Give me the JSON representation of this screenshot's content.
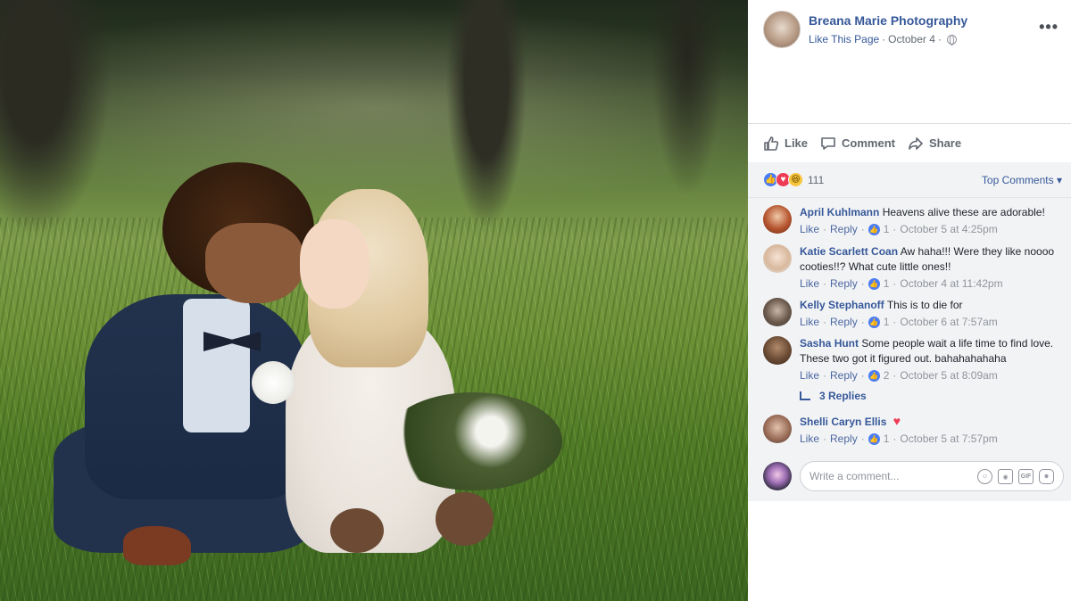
{
  "post": {
    "page_name": "Breana Marie Photography",
    "like_page": "Like This Page",
    "separator": "·",
    "date": "October 4",
    "more_label": "•••"
  },
  "actions": {
    "like": "Like",
    "comment": "Comment",
    "share": "Share"
  },
  "reactions": {
    "count": "111",
    "sort_label": "Top Comments",
    "sort_caret": "▾"
  },
  "comments": [
    {
      "author": "April Kuhlmann",
      "text": "Heavens alive these are adorable!",
      "like": "Like",
      "reply": "Reply",
      "likes": "1",
      "time": "October 5 at 4:25pm"
    },
    {
      "author": "Katie Scarlett Coan",
      "text": "Aw haha!!! Were they like noooo cooties!!? What cute little ones!!",
      "like": "Like",
      "reply": "Reply",
      "likes": "1",
      "time": "October 4 at 11:42pm"
    },
    {
      "author": "Kelly Stephanoff",
      "text": "This is to die for",
      "like": "Like",
      "reply": "Reply",
      "likes": "1",
      "time": "October 6 at 7:57am"
    },
    {
      "author": "Sasha Hunt",
      "text": "Some people wait a life time to find love. These two got it figured out. bahahahahaha",
      "like": "Like",
      "reply": "Reply",
      "likes": "2",
      "time": "October 5 at 8:09am"
    },
    {
      "author": "Shelli Caryn Ellis",
      "text": "",
      "like": "Like",
      "reply": "Reply",
      "likes": "1",
      "time": "October 5 at 7:57pm"
    }
  ],
  "replies_label": "3 Replies",
  "composer": {
    "placeholder": "Write a comment...",
    "gif_label": "GIF"
  },
  "colors": {
    "link": "#365899",
    "like_blue": "#4a7cf3",
    "love_red": "#ee3b56",
    "haha_yellow": "#f7c53c"
  }
}
